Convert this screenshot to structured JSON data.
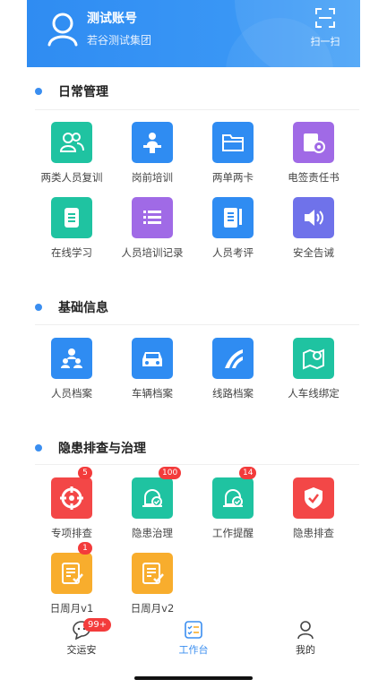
{
  "header": {
    "account_name": "测试账号",
    "org_name": "若谷测试集团",
    "scan_label": "扫一扫"
  },
  "sections": {
    "daily": {
      "title": "日常管理",
      "items": [
        {
          "label": "两类人员复训",
          "icon": "people-icon",
          "color": "#1fc3a1"
        },
        {
          "label": "岗前培训",
          "icon": "lecturer-icon",
          "color": "#2f8cf2"
        },
        {
          "label": "两单两卡",
          "icon": "folder-icon",
          "color": "#2f8cf2"
        },
        {
          "label": "电签责任书",
          "icon": "certificate-icon",
          "color": "#a06ae6"
        },
        {
          "label": "在线学习",
          "icon": "document-icon",
          "color": "#1fc3a1"
        },
        {
          "label": "人员培训记录",
          "icon": "list-icon",
          "color": "#a06ae6"
        },
        {
          "label": "人员考评",
          "icon": "notebook-icon",
          "color": "#2f8cf2"
        },
        {
          "label": "安全告诫",
          "icon": "speaker-icon",
          "color": "#6f72ea"
        }
      ]
    },
    "basic": {
      "title": "基础信息",
      "items": [
        {
          "label": "人员档案",
          "icon": "staff-icon",
          "color": "#2f8cf2"
        },
        {
          "label": "车辆档案",
          "icon": "car-icon",
          "color": "#2f8cf2"
        },
        {
          "label": "线路档案",
          "icon": "road-icon",
          "color": "#2f8cf2"
        },
        {
          "label": "人车线绑定",
          "icon": "map-pin-icon",
          "color": "#1fc3a1"
        }
      ]
    },
    "hazard": {
      "title": "隐患排查与治理",
      "items": [
        {
          "label": "专项排查",
          "icon": "target-icon",
          "color": "#f34747",
          "badge": "5"
        },
        {
          "label": "隐患治理",
          "icon": "alarm-check-icon",
          "color": "#1fc3a1",
          "badge": "100"
        },
        {
          "label": "工作提醒",
          "icon": "alarm-check-icon",
          "color": "#1fc3a1",
          "badge": "14"
        },
        {
          "label": "隐患排查",
          "icon": "shield-check-icon",
          "color": "#f34747"
        },
        {
          "label": "日周月v1",
          "icon": "checklist-icon",
          "color": "#f8ad2d",
          "badge": "1"
        },
        {
          "label": "日周月v2",
          "icon": "checklist-icon",
          "color": "#f8ad2d"
        }
      ]
    }
  },
  "nav": {
    "items": [
      {
        "label": "交运安",
        "badge": "99+",
        "icon": "chat-icon"
      },
      {
        "label": "工作台",
        "icon": "workbench-icon",
        "active": true
      },
      {
        "label": "我的",
        "icon": "person-icon"
      }
    ]
  }
}
